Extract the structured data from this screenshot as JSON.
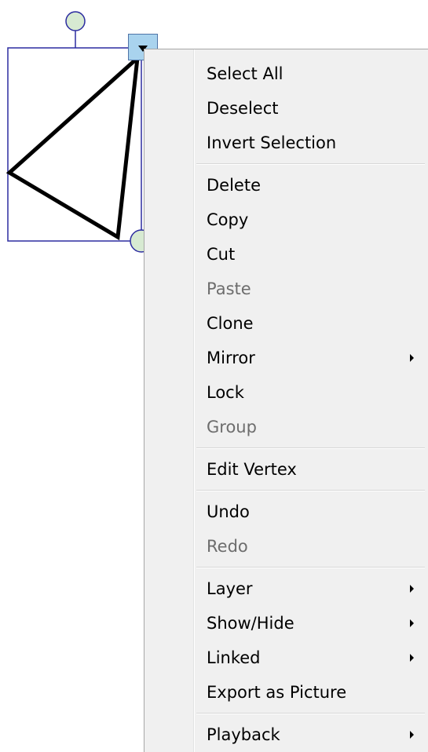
{
  "selection": {
    "shape_name": "triangle",
    "toggle_icon": "dropdown-arrow-icon",
    "handle_color": "#d7ead2",
    "frame_color": "#2c2ca0"
  },
  "context_menu": {
    "groups": [
      {
        "items": [
          {
            "label": "Select All",
            "enabled": true,
            "submenu": false,
            "name": "select-all"
          },
          {
            "label": "Deselect",
            "enabled": true,
            "submenu": false,
            "name": "deselect"
          },
          {
            "label": "Invert Selection",
            "enabled": true,
            "submenu": false,
            "name": "invert-selection"
          }
        ]
      },
      {
        "items": [
          {
            "label": "Delete",
            "enabled": true,
            "submenu": false,
            "name": "delete"
          },
          {
            "label": "Copy",
            "enabled": true,
            "submenu": false,
            "name": "copy"
          },
          {
            "label": "Cut",
            "enabled": true,
            "submenu": false,
            "name": "cut"
          },
          {
            "label": "Paste",
            "enabled": false,
            "submenu": false,
            "name": "paste"
          },
          {
            "label": "Clone",
            "enabled": true,
            "submenu": false,
            "name": "clone"
          },
          {
            "label": "Mirror",
            "enabled": true,
            "submenu": true,
            "name": "mirror"
          },
          {
            "label": "Lock",
            "enabled": true,
            "submenu": false,
            "name": "lock"
          },
          {
            "label": "Group",
            "enabled": false,
            "submenu": false,
            "name": "group"
          }
        ]
      },
      {
        "items": [
          {
            "label": "Edit Vertex",
            "enabled": true,
            "submenu": false,
            "name": "edit-vertex"
          }
        ]
      },
      {
        "items": [
          {
            "label": "Undo",
            "enabled": true,
            "submenu": false,
            "name": "undo"
          },
          {
            "label": "Redo",
            "enabled": false,
            "submenu": false,
            "name": "redo"
          }
        ]
      },
      {
        "items": [
          {
            "label": "Layer",
            "enabled": true,
            "submenu": true,
            "name": "layer"
          },
          {
            "label": "Show/Hide",
            "enabled": true,
            "submenu": true,
            "name": "show-hide"
          },
          {
            "label": "Linked",
            "enabled": true,
            "submenu": true,
            "name": "linked"
          },
          {
            "label": "Export as Picture",
            "enabled": true,
            "submenu": false,
            "name": "export-as-picture"
          }
        ]
      },
      {
        "items": [
          {
            "label": "Playback",
            "enabled": true,
            "submenu": true,
            "name": "playback"
          }
        ]
      }
    ]
  }
}
